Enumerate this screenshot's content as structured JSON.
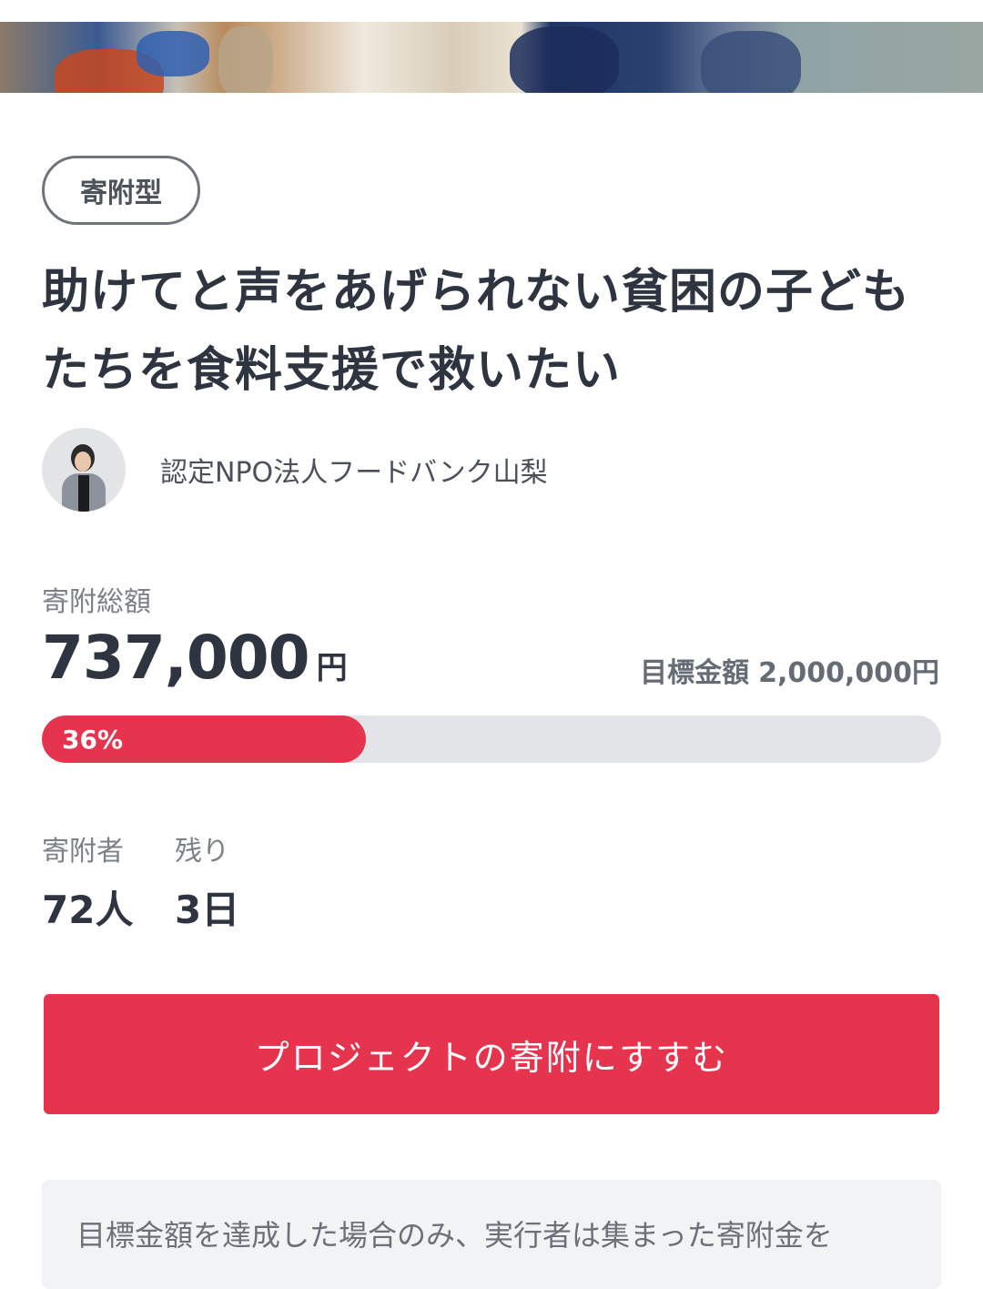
{
  "project": {
    "type_tag": "寄附型",
    "title": "助けてと声をあげられない貧困の子どもたちを食料支援で救いたい",
    "organization": "認定NPO法人フードバンク山梨"
  },
  "funding": {
    "total_label": "寄附総額",
    "total_amount": "737,000",
    "total_unit": "円",
    "goal_label": "目標金額",
    "goal_amount": "2,000,000円",
    "progress_percent": 36,
    "progress_text": "36%",
    "progress_color": "#e6344e"
  },
  "stats": {
    "donors_label": "寄附者",
    "donors_value": "72人",
    "remaining_label": "残り",
    "remaining_value": "3日"
  },
  "cta": {
    "label": "プロジェクトの寄附にすすむ",
    "color": "#e6344e"
  },
  "note": {
    "text": "目標金額を達成した場合のみ、実行者は集まった寄附金を"
  },
  "icons": {
    "avatar": "organization-representative-avatar"
  }
}
